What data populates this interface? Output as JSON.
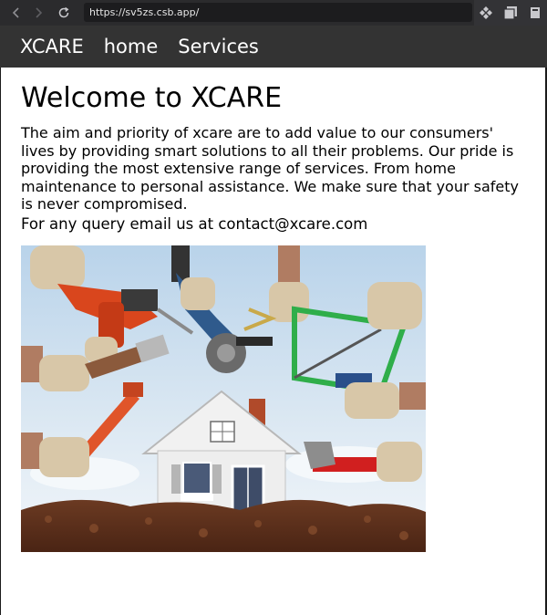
{
  "browser": {
    "url": "https://sv5zs.csb.app/",
    "icons": {
      "back": "chevron-left-icon",
      "forward": "chevron-right-icon",
      "reload": "reload-icon",
      "extension": "extension-icon",
      "tabs": "tabs-icon",
      "menu": "menu-icon"
    }
  },
  "navbar": {
    "brand": "XCARE",
    "links": [
      "home",
      "Services"
    ],
    "background": "#333333"
  },
  "main": {
    "title": "Welcome to XCARE",
    "intro": "The aim and priority of xcare are to add value to our consumers' lives by providing smart solutions to all their problems. Our pride is providing the most extensive range of services. From home maintenance to personal assistance. We make sure that your safety is never compromised.",
    "contact": "For any query email us at contact@xcare.com"
  }
}
